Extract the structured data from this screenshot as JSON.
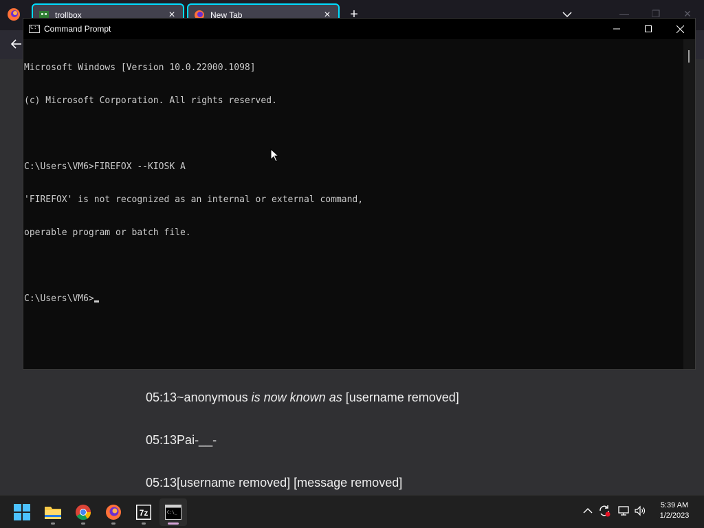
{
  "browser": {
    "tabs": [
      {
        "title": "trollbox"
      },
      {
        "title": "New Tab"
      }
    ]
  },
  "chat": {
    "messages": [
      {
        "time": "05:13",
        "user": "~anonymous",
        "action": "is now known as",
        "target": "[username removed]"
      },
      {
        "time": "05:13",
        "user": "Pai-__-"
      },
      {
        "time": "05:13",
        "user": "[username removed]",
        "text": "[message removed]"
      }
    ]
  },
  "cmd": {
    "title": "Command Prompt",
    "lines": [
      "Microsoft Windows [Version 10.0.22000.1098]",
      "(c) Microsoft Corporation. All rights reserved.",
      "",
      "C:\\Users\\VM6>FIREFOX --KIOSK A",
      "'FIREFOX' is not recognized as an internal or external command,",
      "operable program or batch file.",
      ""
    ],
    "prompt": "C:\\Users\\VM6>"
  },
  "taskbar": {
    "items": [
      "start-icon",
      "file-explorer-icon",
      "chrome-icon",
      "firefox-icon",
      "7zip-icon",
      "command-prompt-icon"
    ],
    "clock": {
      "time": "5:39 AM",
      "date": "1/2/2023"
    }
  },
  "colors": {
    "terminal_bg": "#0c0c0c",
    "terminal_text": "#cccccc",
    "tab_accent": "#00ddff",
    "taskbar_bg": "#202020"
  }
}
